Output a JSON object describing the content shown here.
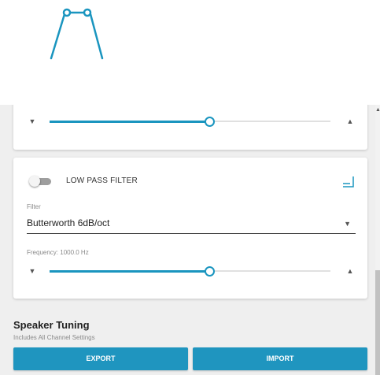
{
  "colors": {
    "accent": "#1a95bf",
    "button": "#1f95bf",
    "panel_bg": "#efefef"
  },
  "filter_graphic": {
    "icon": "low-pass-filter-curve-icon"
  },
  "top_slider": {
    "icons": [
      "arrow-down-icon",
      "arrow-up-icon"
    ],
    "value_fraction": 0.57
  },
  "low_pass_filter": {
    "toggle_on": false,
    "label": "LOW PASS FILTER",
    "corner_icon": "expand-corner-icon",
    "filter_label": "Filter",
    "filter_value": "Butterworth 6dB/oct",
    "frequency_label": "Frequency: 1000.0 Hz",
    "frequency_fraction": 0.57
  },
  "speaker_tuning": {
    "title": "Speaker Tuning",
    "subtitle": "Includes All Channel Settings",
    "export_label": "EXPORT",
    "import_label": "IMPORT"
  }
}
